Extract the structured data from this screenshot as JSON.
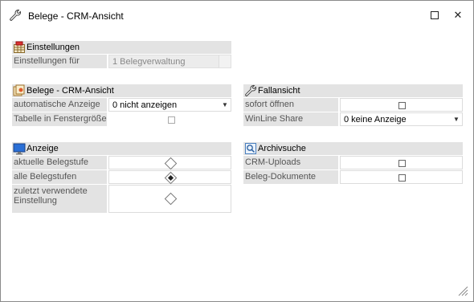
{
  "window": {
    "title": "Belege - CRM-Ansicht",
    "icons": {
      "app": "wrench-icon",
      "maximize": "maximize-icon",
      "close": "close-icon"
    },
    "close_glyph": "✕"
  },
  "einstellungen": {
    "title": "Einstellungen",
    "icon": "settings-grid-icon",
    "rows": [
      {
        "label": "Einstellungen für",
        "value": "1 Belegverwaltung"
      }
    ]
  },
  "belege": {
    "title": "Belege - CRM-Ansicht",
    "icon": "documents-icon",
    "rows": [
      {
        "label": "automatische Anzeige",
        "value": "0 nicht anzeigen"
      },
      {
        "label": "Tabelle in Fenstergröße",
        "checked": false
      }
    ]
  },
  "fallansicht": {
    "title": "Fallansicht",
    "icon": "wrench-icon",
    "rows": [
      {
        "label": "sofort öffnen",
        "checked": false
      },
      {
        "label": "WinLine Share",
        "value": "0 keine Anzeige"
      }
    ]
  },
  "anzeige": {
    "title": "Anzeige",
    "icon": "monitor-icon",
    "rows": [
      {
        "label": "aktuelle Belegstufe",
        "selected": false
      },
      {
        "label": "alle Belegstufen",
        "selected": true
      },
      {
        "label": "zuletzt verwendete Einstellung",
        "selected": false
      }
    ]
  },
  "archivsuche": {
    "title": "Archivsuche",
    "icon": "archive-search-icon",
    "rows": [
      {
        "label": "CRM-Uploads",
        "checked": false
      },
      {
        "label": "Beleg-Dokumente",
        "checked": false
      }
    ]
  },
  "colors": {
    "label_bg": "#e3e3e3",
    "label_text": "#555555",
    "border": "#dcdcdc"
  }
}
